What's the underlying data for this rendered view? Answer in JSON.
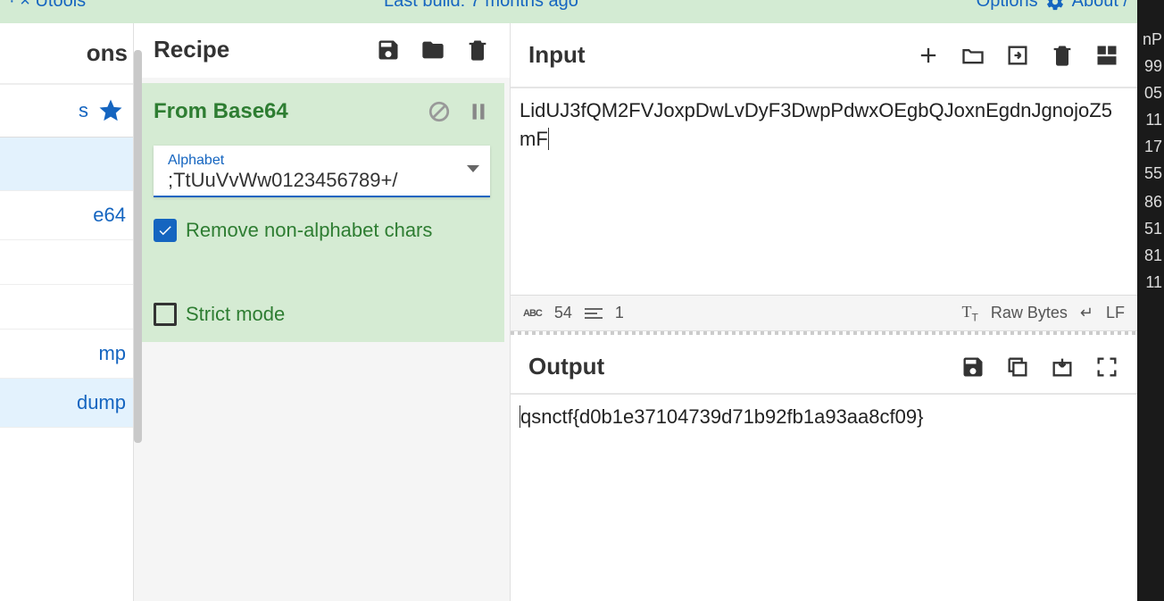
{
  "topbar": {
    "left_fragment": "· × Utools",
    "mid_fragment": "Last build: 7 months ago",
    "options_label": "Options",
    "about_label": "About /"
  },
  "rightstrip": [
    "nP",
    "99",
    "05",
    "11",
    "17",
    "55",
    "",
    "86",
    "51",
    "81",
    "11"
  ],
  "operations": {
    "header": "ons",
    "search_fragment": "s",
    "items": [
      "e64",
      "",
      "",
      "mp",
      "dump"
    ]
  },
  "recipe": {
    "header": "Recipe",
    "op": {
      "title": "From Base64",
      "alphabet_label": "Alphabet",
      "alphabet_value": ";TtUuVvWw0123456789+/",
      "remove_label": "Remove non-alphabet chars",
      "strict_label": "Strict mode"
    }
  },
  "input": {
    "header": "Input",
    "text": "LidUJ3fQM2FVJoxpDwLvDyF3DwpPdwxOEgbQJoxnEgdnJgnojoZ5mF"
  },
  "status": {
    "char_count": "54",
    "line_count": "1",
    "encoding": "Raw Bytes",
    "eol": "LF"
  },
  "output": {
    "header": "Output",
    "text": "qsnctf{d0b1e37104739d71b92fb1a93aa8cf09}"
  }
}
